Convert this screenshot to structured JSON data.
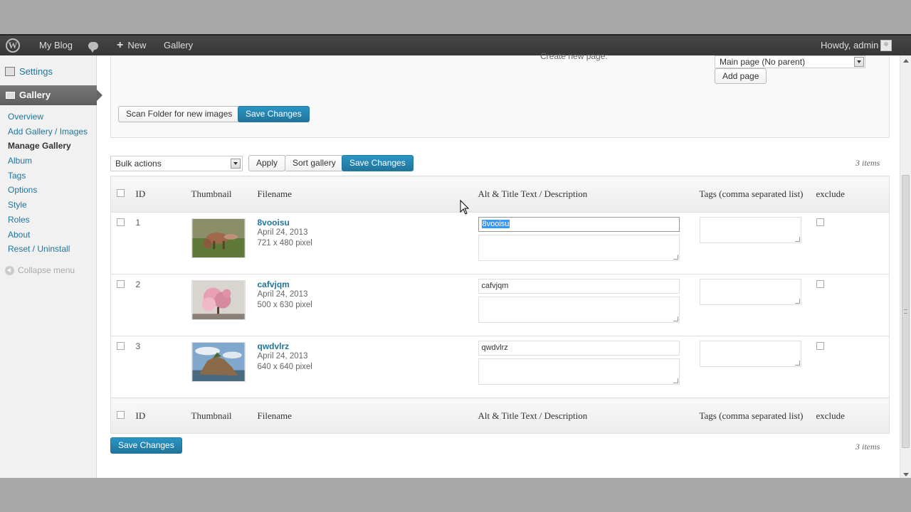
{
  "adminbar": {
    "blog": "My Blog",
    "new": "New",
    "gallery": "Gallery",
    "howdy": "Howdy, admin"
  },
  "sidebar": {
    "settings": "Settings",
    "gallery": "Gallery",
    "items": [
      {
        "label": "Overview"
      },
      {
        "label": "Add Gallery / Images"
      },
      {
        "label": "Manage Gallery"
      },
      {
        "label": "Album"
      },
      {
        "label": "Tags"
      },
      {
        "label": "Options"
      },
      {
        "label": "Style"
      },
      {
        "label": "Roles"
      },
      {
        "label": "About"
      },
      {
        "label": "Reset / Uninstall"
      }
    ],
    "collapse": "Collapse menu"
  },
  "options": {
    "create_text": "Create new page:",
    "parent_select": "Main page (No parent)",
    "add_page": "Add page",
    "scan_folder": "Scan Folder for new images",
    "save_changes": "Save Changes"
  },
  "tablenav": {
    "bulk_actions": "Bulk actions",
    "apply": "Apply",
    "sort_gallery": "Sort gallery",
    "save_changes": "Save Changes",
    "count": "3 items"
  },
  "table": {
    "headers": {
      "id": "ID",
      "thumbnail": "Thumbnail",
      "filename": "Filename",
      "alt": "Alt & Title Text / Description",
      "tags": "Tags (comma separated list)",
      "exclude": "exclude"
    },
    "rows": [
      {
        "id": "1",
        "filename": "8vooisu",
        "date": "April 24, 2013",
        "size": "721 x 480 pixel",
        "alt": "8vooisu",
        "description": "",
        "tags": ""
      },
      {
        "id": "2",
        "filename": "cafvjqm",
        "date": "April 24, 2013",
        "size": "500 x 630 pixel",
        "alt": "cafvjqm",
        "description": "",
        "tags": ""
      },
      {
        "id": "3",
        "filename": "qwdvlrz",
        "date": "April 24, 2013",
        "size": "640 x 640 pixel",
        "alt": "qwdvlrz",
        "description": "",
        "tags": ""
      }
    ]
  },
  "footer": {
    "save_changes": "Save Changes",
    "count": "3 items"
  },
  "colors": {
    "primary_button": "#21759b",
    "link": "#21759b",
    "adminbar": "#464646",
    "selection": "#3399ff"
  },
  "icons": [
    "wordpress-logo-icon",
    "comment-bubble-icon",
    "plus-icon",
    "avatar-icon",
    "settings-icon",
    "gallery-icon",
    "collapse-arrow-icon",
    "dropdown-arrow-icon",
    "mouse-cursor-icon"
  ]
}
